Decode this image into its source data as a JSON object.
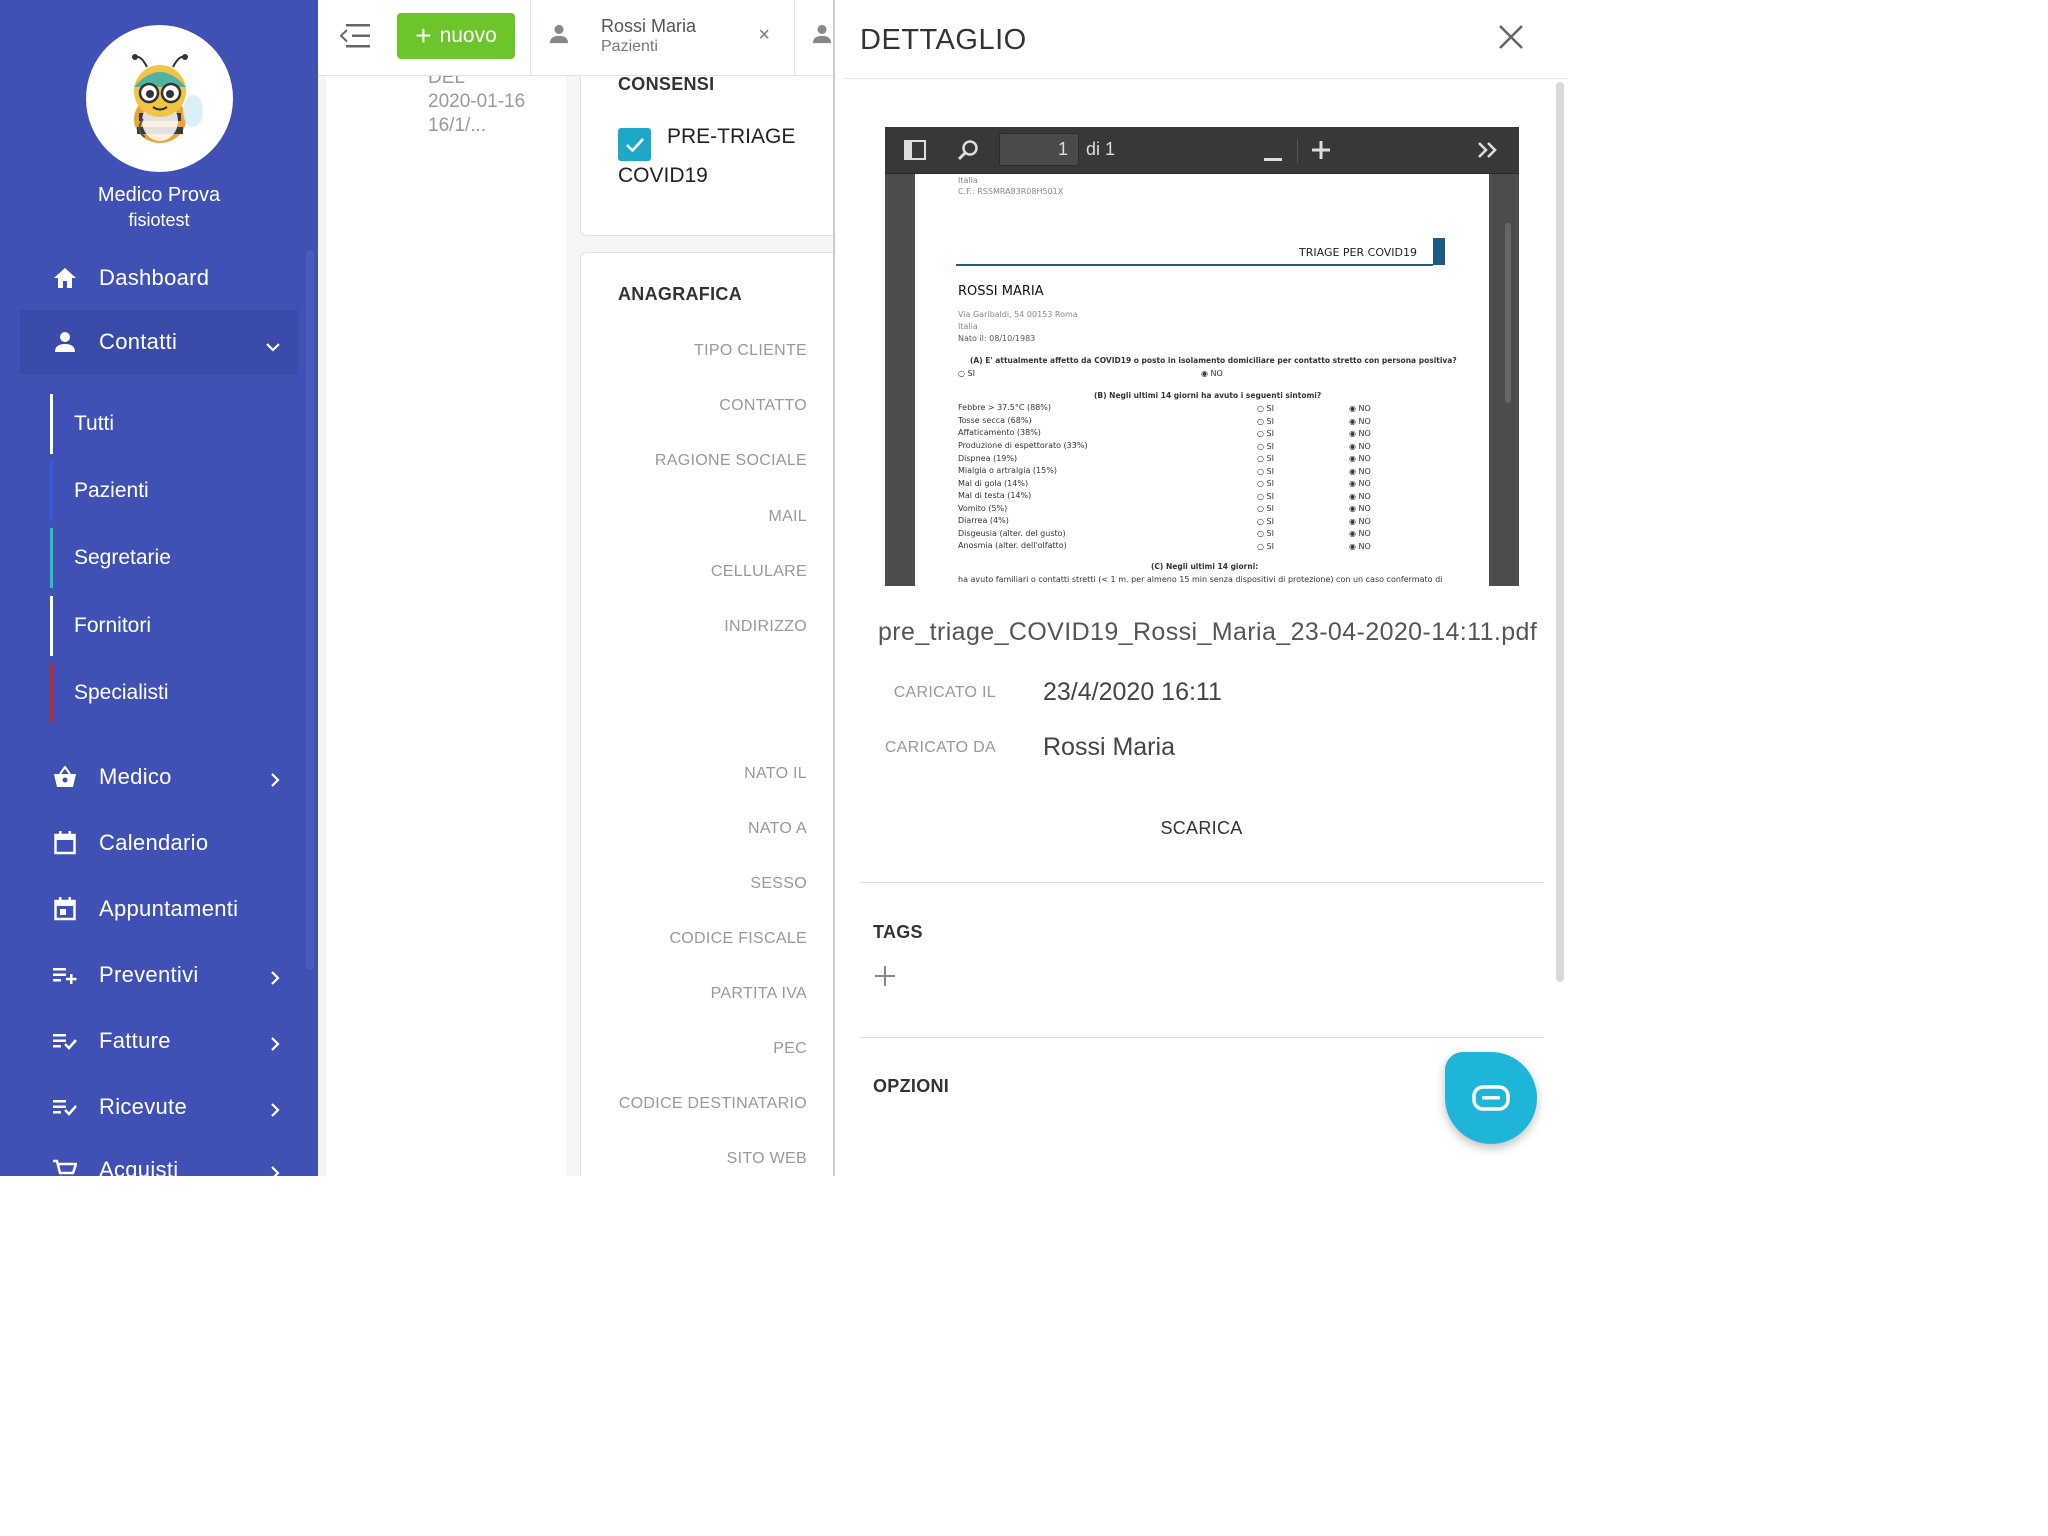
{
  "sidebar": {
    "user_name": "Medico Prova",
    "user_role": "fisiotest",
    "items": [
      {
        "label": "Dashboard",
        "icon": "home-icon"
      },
      {
        "label": "Contatti",
        "icon": "person-icon"
      },
      {
        "label": "Medico",
        "icon": "basket-icon"
      },
      {
        "label": "Calendario",
        "icon": "calendar-icon"
      },
      {
        "label": "Appuntamenti",
        "icon": "event-icon"
      },
      {
        "label": "Preventivi",
        "icon": "playlist-add-icon"
      },
      {
        "label": "Fatture",
        "icon": "playlist-check-icon"
      },
      {
        "label": "Ricevute",
        "icon": "playlist-check-icon"
      },
      {
        "label": "Acquisti",
        "icon": "cart-icon"
      }
    ],
    "sub_items": [
      {
        "label": "Tutti",
        "color": "#ffffff"
      },
      {
        "label": "Pazienti",
        "color": "#2d5be3"
      },
      {
        "label": "Segretarie",
        "color": "#2bc4b4"
      },
      {
        "label": "Fornitori",
        "color": "#ffffff"
      },
      {
        "label": "Specialisti",
        "color": "#c62828"
      }
    ]
  },
  "topbar": {
    "new_label": "nuovo",
    "tab_name": "Rossi Maria",
    "tab_sub": "Pazienti",
    "tab_close": "×"
  },
  "main": {
    "dates": [
      "DEL",
      "2020-01-16",
      "16/1/..."
    ],
    "consensi_title": "CONSENSI",
    "consent_label": "PRE-TRIAGE COVID19",
    "anagrafica_title": "ANAGRAFICA",
    "fields": [
      "TIPO CLIENTE",
      "CONTATTO",
      "RAGIONE SOCIALE",
      "MAIL",
      "CELLULARE",
      "INDIRIZZO",
      "NATO IL",
      "NATO A",
      "SESSO",
      "CODICE FISCALE",
      "PARTITA IVA",
      "PEC",
      "CODICE DESTINATARIO",
      "SITO WEB"
    ]
  },
  "panel": {
    "title": "DETTAGLIO",
    "viewer": {
      "page": "1",
      "page_of": "di 1"
    },
    "pdf": {
      "country": "Italia",
      "cf": "C.F.: RSSMRA83R08H501X",
      "header": "TRIAGE PER COVID19",
      "patient": "ROSSI MARIA",
      "address": "Via Garibaldi, 54 00153 Roma",
      "country2": "Italia",
      "born": "Nato il: 08/10/1983",
      "qa": "(A) E' attualmente affetto da COVID19 o posto in isolamento domiciliare per contatto stretto con persona positiva?",
      "si": "○ SI",
      "no": "◉ NO",
      "qb": "(B) Negli ultimi 14 giorni ha avuto i seguenti sintomi?",
      "symptoms": [
        "Febbre > 37.5°C (88%)",
        "Tosse secca (68%)",
        "Affaticamento (38%)",
        "Produzione di espettorato (33%)",
        "Dispnea (19%)",
        "Mialgia o artralgia (15%)",
        "Mal di gola (14%)",
        "Mal di testa (14%)",
        "Vomito (5%)",
        "Diarrea (4%)",
        "Disgeusia (alter. del gusto)",
        "Anosmia (alter. dell'olfatto)"
      ],
      "qc": "(C) Negli ultimi 14 giorni:",
      "qc_text": "ha avuto familiari o contatti stretti (< 1 m. per almeno 15 min senza dispositivi di protezione) con un caso confermato di"
    },
    "filename": "pre_triage_COVID19_Rossi_Maria_23-04-2020-14:11.pdf",
    "uploaded_at_label": "CARICATO IL",
    "uploaded_at": "23/4/2020 16:11",
    "uploaded_by_label": "CARICATO DA",
    "uploaded_by": "Rossi Maria",
    "download_label": "SCARICA",
    "tags_title": "TAGS",
    "options_title": "OPZIONI"
  }
}
